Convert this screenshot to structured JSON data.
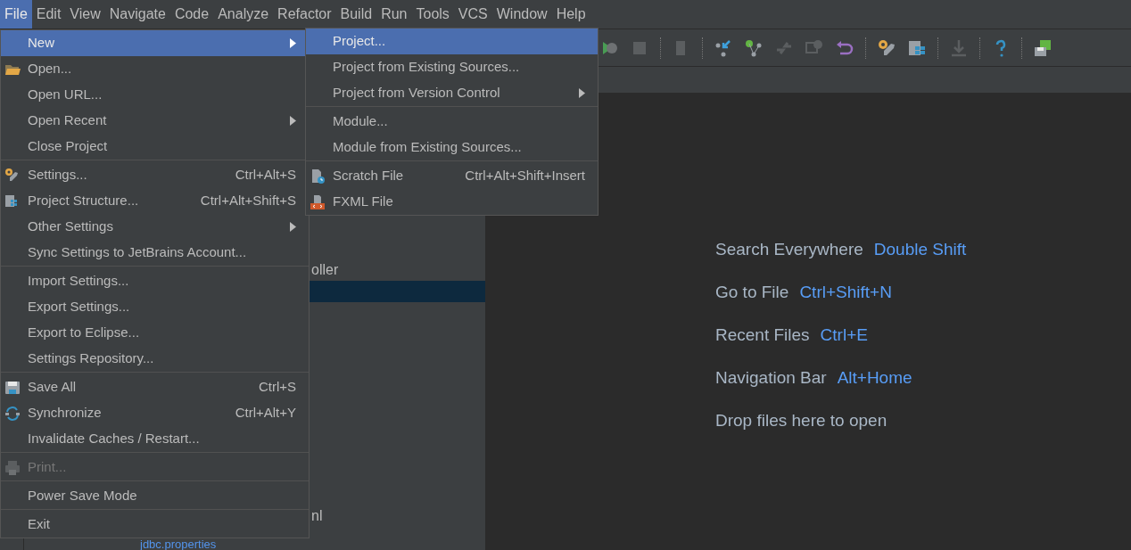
{
  "menu_bar": [
    {
      "label": "File",
      "selected": true
    },
    {
      "label": "Edit",
      "selected": false
    },
    {
      "label": "View",
      "selected": false
    },
    {
      "label": "Navigate",
      "selected": false
    },
    {
      "label": "Code",
      "selected": false
    },
    {
      "label": "Analyze",
      "selected": false
    },
    {
      "label": "Refactor",
      "selected": false
    },
    {
      "label": "Build",
      "selected": false
    },
    {
      "label": "Run",
      "selected": false
    },
    {
      "label": "Tools",
      "selected": false
    },
    {
      "label": "VCS",
      "selected": false
    },
    {
      "label": "Window",
      "selected": false
    },
    {
      "label": "Help",
      "selected": false
    }
  ],
  "file_menu": [
    [
      {
        "label": "New",
        "submenu": true,
        "selected": true,
        "disabled": false
      },
      {
        "label": "Open...",
        "submenu": false,
        "selected": false,
        "disabled": false
      },
      {
        "label": "Open URL...",
        "submenu": false,
        "selected": false,
        "disabled": false
      },
      {
        "label": "Open Recent",
        "submenu": true,
        "selected": false,
        "disabled": false
      },
      {
        "label": "Close Project",
        "submenu": false,
        "selected": false,
        "disabled": false
      }
    ],
    [
      {
        "label": "Settings...",
        "shortcut": "Ctrl+Alt+S",
        "submenu": false,
        "selected": false,
        "disabled": false
      },
      {
        "label": "Project Structure...",
        "shortcut": "Ctrl+Alt+Shift+S",
        "submenu": false,
        "selected": false,
        "disabled": false
      },
      {
        "label": "Other Settings",
        "submenu": true,
        "selected": false,
        "disabled": false
      },
      {
        "label": "Sync Settings to JetBrains Account...",
        "submenu": false,
        "selected": false,
        "disabled": false
      }
    ],
    [
      {
        "label": "Import Settings...",
        "submenu": false,
        "selected": false,
        "disabled": false
      },
      {
        "label": "Export Settings...",
        "submenu": false,
        "selected": false,
        "disabled": false
      },
      {
        "label": "Export to Eclipse...",
        "submenu": false,
        "selected": false,
        "disabled": false
      },
      {
        "label": "Settings Repository...",
        "submenu": false,
        "selected": false,
        "disabled": false
      }
    ],
    [
      {
        "label": "Save All",
        "shortcut": "Ctrl+S",
        "submenu": false,
        "selected": false,
        "disabled": false
      },
      {
        "label": "Synchronize",
        "shortcut": "Ctrl+Alt+Y",
        "submenu": false,
        "selected": false,
        "disabled": false
      },
      {
        "label": "Invalidate Caches / Restart...",
        "submenu": false,
        "selected": false,
        "disabled": false
      }
    ],
    [
      {
        "label": "Print...",
        "submenu": false,
        "selected": false,
        "disabled": true
      }
    ],
    [
      {
        "label": "Power Save Mode",
        "submenu": false,
        "selected": false,
        "disabled": false
      }
    ],
    [
      {
        "label": "Exit",
        "submenu": false,
        "selected": false,
        "disabled": false
      }
    ]
  ],
  "new_submenu": [
    [
      {
        "label": "Project...",
        "submenu": false,
        "selected": true,
        "disabled": false
      },
      {
        "label": "Project from Existing Sources...",
        "submenu": false,
        "selected": false,
        "disabled": false
      },
      {
        "label": "Project from Version Control",
        "submenu": true,
        "selected": false,
        "disabled": false
      }
    ],
    [
      {
        "label": "Module...",
        "submenu": false,
        "selected": false,
        "disabled": false
      },
      {
        "label": "Module from Existing Sources...",
        "submenu": false,
        "selected": false,
        "disabled": false
      }
    ],
    [
      {
        "label": "Scratch File",
        "shortcut": "Ctrl+Alt+Shift+Insert",
        "submenu": false,
        "selected": false,
        "disabled": false
      },
      {
        "label": "FXML File",
        "submenu": false,
        "selected": false,
        "disabled": false
      }
    ]
  ],
  "project_tree": [
    {
      "label": "oller",
      "selected": false
    },
    {
      "selected": true
    },
    {
      "label": "nl",
      "selected": false
    },
    {
      "label": "jdbc.properties",
      "selected": false
    }
  ],
  "editor_hints": [
    {
      "label": "Search Everywhere",
      "shortcut": "Double Shift"
    },
    {
      "label": "Go to File",
      "shortcut": "Ctrl+Shift+N"
    },
    {
      "label": "Recent Files",
      "shortcut": "Ctrl+E"
    },
    {
      "label": "Navigation Bar",
      "shortcut": "Alt+Home"
    },
    {
      "label": "Drop files here to open"
    }
  ]
}
